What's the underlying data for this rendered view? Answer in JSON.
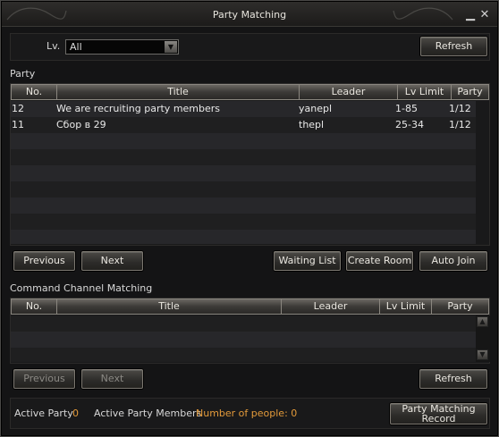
{
  "window": {
    "title": "Party Matching"
  },
  "filter": {
    "level_label": "Lv.",
    "level_value": "All",
    "refresh_label": "Refresh"
  },
  "party": {
    "section_label": "Party",
    "columns": [
      "No.",
      "Title",
      "Leader",
      "Lv Limit",
      "Party"
    ],
    "rows": [
      {
        "no": "12",
        "title": "We are recruiting party members",
        "leader": "yanepl",
        "lv_limit": "1-85",
        "party": "1/12"
      },
      {
        "no": "11",
        "title": "Сбор в 29",
        "leader": "thepl",
        "lv_limit": "25-34",
        "party": "1/12"
      }
    ],
    "buttons": {
      "previous": "Previous",
      "next": "Next",
      "waiting_list": "Waiting List",
      "create_room": "Create Room",
      "auto_join": "Auto Join"
    }
  },
  "command_channel": {
    "section_label": "Command Channel Matching",
    "columns": [
      "No.",
      "Title",
      "Leader",
      "Lv Limit",
      "Party"
    ],
    "buttons": {
      "previous": "Previous",
      "next": "Next",
      "refresh": "Refresh"
    }
  },
  "footer": {
    "active_party_label": "Active Party",
    "active_party_value": "0",
    "active_members_label": "Active Party Members",
    "active_members_value": "Number of people: 0",
    "record_button": "Party Matching Record"
  },
  "colors": {
    "accent_orange": "#e39a3a",
    "window_bg": "#141415",
    "header_gradient_top": "#6a6762"
  },
  "icons": {
    "minimize": "minimize-icon",
    "close": "close-icon",
    "dropdown": "chevron-down-icon",
    "scroll_up": "scroll-up-icon",
    "scroll_down": "scroll-down-icon"
  }
}
